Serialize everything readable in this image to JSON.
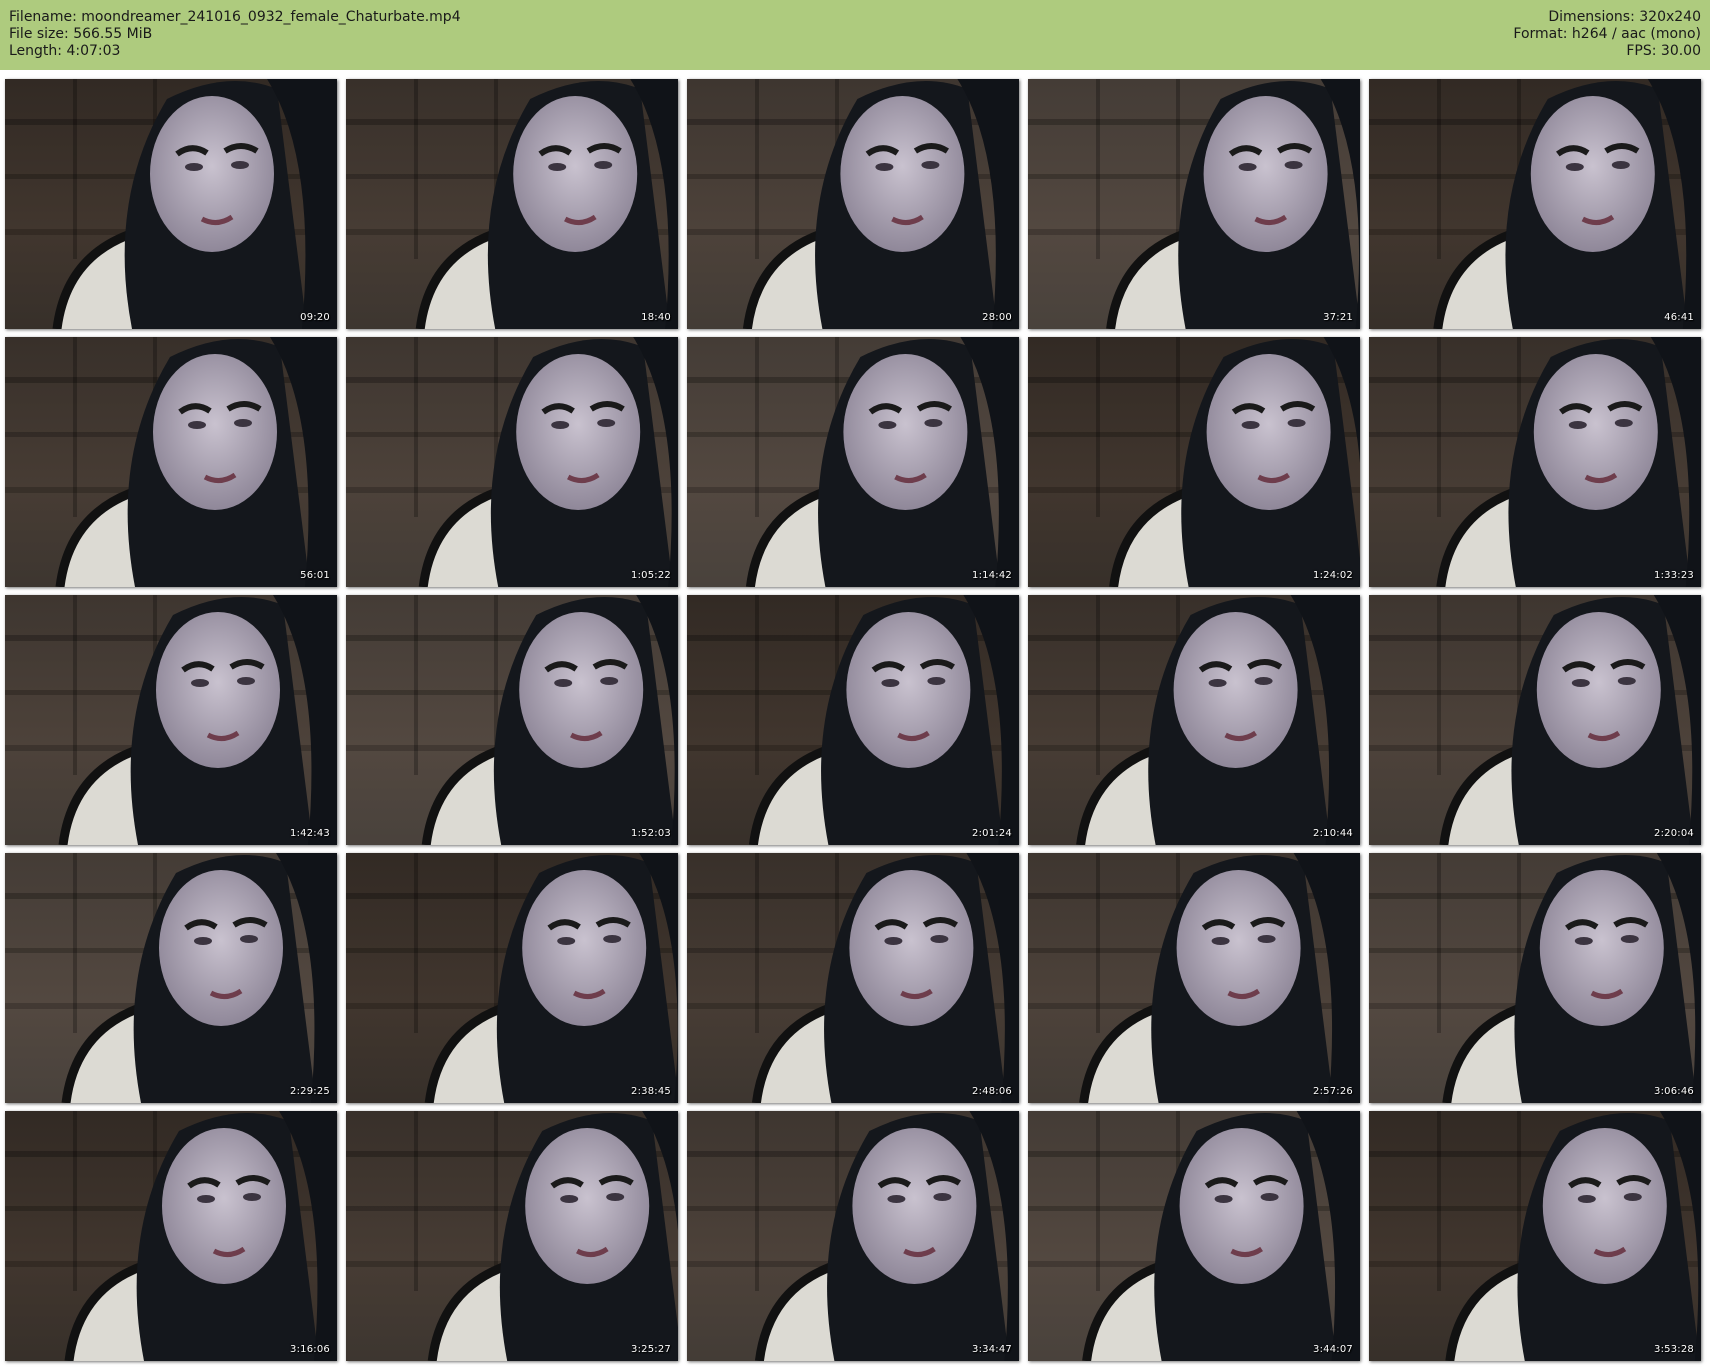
{
  "header": {
    "filename": "Filename: moondreamer_241016_0932_female_Chaturbate.mp4",
    "filesize": "File size: 566.55 MiB",
    "length": "Length: 4:07:03",
    "dimensions": "Dimensions: 320x240",
    "format": "Format: h264 / aac (mono)",
    "fps": "FPS: 30.00"
  },
  "colors": {
    "header_bg": "#aecb7e",
    "page_bg": "#ffffff",
    "timestamp_text": "#ffffff"
  },
  "grid": {
    "columns": 5,
    "rows": 5
  },
  "thumbnails": [
    {
      "timestamp": "09:20"
    },
    {
      "timestamp": "18:40"
    },
    {
      "timestamp": "28:00"
    },
    {
      "timestamp": "37:21"
    },
    {
      "timestamp": "46:41"
    },
    {
      "timestamp": "56:01"
    },
    {
      "timestamp": "1:05:22"
    },
    {
      "timestamp": "1:14:42"
    },
    {
      "timestamp": "1:24:02"
    },
    {
      "timestamp": "1:33:23"
    },
    {
      "timestamp": "1:42:43"
    },
    {
      "timestamp": "1:52:03"
    },
    {
      "timestamp": "2:01:24"
    },
    {
      "timestamp": "2:10:44"
    },
    {
      "timestamp": "2:20:04"
    },
    {
      "timestamp": "2:29:25"
    },
    {
      "timestamp": "2:38:45"
    },
    {
      "timestamp": "2:48:06"
    },
    {
      "timestamp": "2:57:26"
    },
    {
      "timestamp": "3:06:46"
    },
    {
      "timestamp": "3:16:06"
    },
    {
      "timestamp": "3:25:27"
    },
    {
      "timestamp": "3:34:47"
    },
    {
      "timestamp": "3:44:07"
    },
    {
      "timestamp": "3:53:28"
    }
  ]
}
